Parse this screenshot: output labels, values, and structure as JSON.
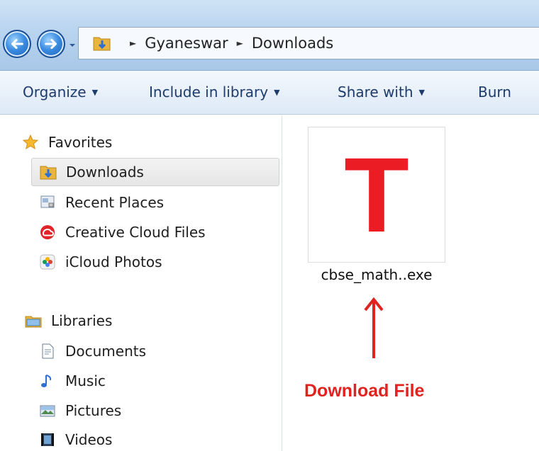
{
  "window": {
    "breadcrumb": [
      "Gyaneswar",
      "Downloads"
    ]
  },
  "toolbar": {
    "organize_label": "Organize",
    "include_label": "Include in library",
    "share_label": "Share with",
    "burn_label": "Burn"
  },
  "sidebar": {
    "favorites_header": "Favorites",
    "favorites": [
      {
        "label": "Downloads",
        "icon": "downloads-folder-icon",
        "selected": true
      },
      {
        "label": "Recent Places",
        "icon": "recent-places-icon"
      },
      {
        "label": "Creative Cloud Files",
        "icon": "creative-cloud-icon"
      },
      {
        "label": "iCloud Photos",
        "icon": "icloud-photos-icon"
      }
    ],
    "libraries_header": "Libraries",
    "libraries": [
      {
        "label": "Documents",
        "icon": "documents-icon"
      },
      {
        "label": "Music",
        "icon": "music-icon"
      },
      {
        "label": "Pictures",
        "icon": "pictures-icon"
      },
      {
        "label": "Videos",
        "icon": "videos-icon"
      }
    ]
  },
  "content": {
    "file": {
      "name": "cbse_math..exe",
      "glyph": "T"
    },
    "annotation": "Download File"
  },
  "colors": {
    "accent": "#1c5fb6",
    "file_glyph": "#ec1c24",
    "annotation": "#e0231f"
  }
}
